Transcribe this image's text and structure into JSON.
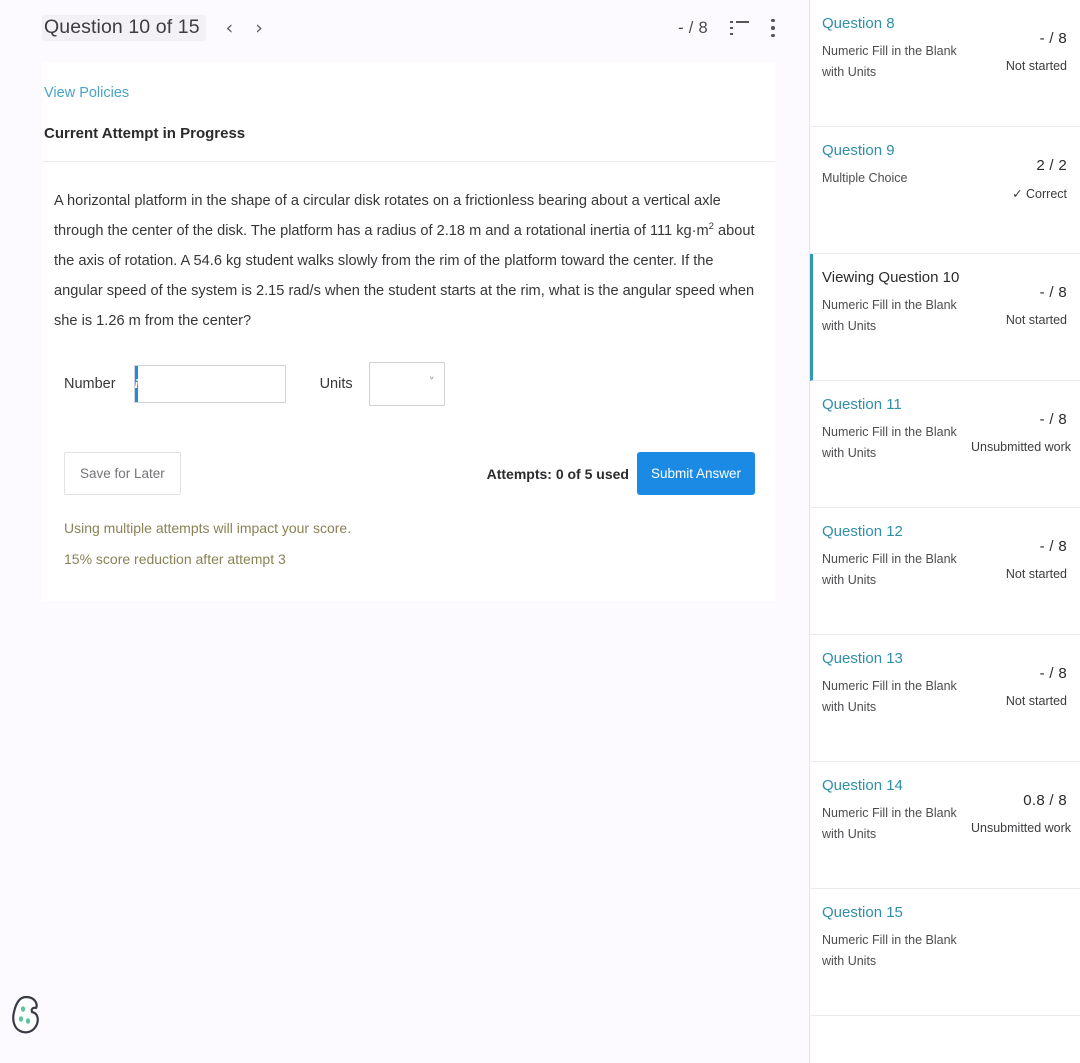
{
  "header": {
    "title": "Question 10 of 15",
    "prev_arrow": "‹",
    "next_arrow": "›",
    "score": "- / 8",
    "list_icon": "list-icon",
    "menu_icon": "kebab-menu-icon"
  },
  "card": {
    "policies_link": "View Policies",
    "attempt_heading": "Current Attempt in Progress",
    "question_text_part1": "A horizontal platform in the shape of a circular disk rotates on a frictionless bearing about a vertical axle through the center of the disk. The platform has a radius of 2.18 m and a rotational inertia of 111 kg·m",
    "question_exponent": "2",
    "question_text_part2": " about the axis of rotation. A 54.6 kg student walks slowly from the rim of the platform toward the center. If the angular speed of the system is 2.15 rad/s when the student starts at the rim, what is the angular speed when she is 1.26 m from the center?",
    "number_label": "Number",
    "number_value": "",
    "number_placeholder": "",
    "info_badge": "i",
    "units_label": "Units",
    "units_value": "",
    "units_chevron": "˅",
    "save_label": "Save for Later",
    "attempts_text": "Attempts: 0 of 5 used",
    "submit_label": "Submit Answer",
    "notice_1": "Using multiple attempts will impact your score.",
    "notice_2": "15% score reduction after attempt 3"
  },
  "sidebar": {
    "questions": [
      {
        "name": "Question 8",
        "type": "Numeric Fill in the Blank with Units",
        "score": "- / 8",
        "status": "Not started",
        "active": false
      },
      {
        "name": "Question 9",
        "type": "Multiple Choice",
        "score": "2 / 2",
        "status": "✓ Correct",
        "active": false
      },
      {
        "name": "Viewing Question 10",
        "type": "Numeric Fill in the Blank with Units",
        "score": "- / 8",
        "status": "Not started",
        "active": true
      },
      {
        "name": "Question 11",
        "type": "Numeric Fill in the Blank with Units",
        "score": "- / 8",
        "status": "Unsubmitted work",
        "active": false
      },
      {
        "name": "Question 12",
        "type": "Numeric Fill in the Blank with Units",
        "score": "- / 8",
        "status": "Not started",
        "active": false
      },
      {
        "name": "Question 13",
        "type": "Numeric Fill in the Blank with Units",
        "score": "- / 8",
        "status": "Not started",
        "active": false
      },
      {
        "name": "Question 14",
        "type": "Numeric Fill in the Blank with Units",
        "score": "0.8 / 8",
        "status": "Unsubmitted work",
        "active": false
      },
      {
        "name": "Question 15",
        "type": "Numeric Fill in the Blank with Units",
        "score": "",
        "status": "",
        "active": false
      }
    ]
  },
  "overlay": {
    "thumbnail": "browser-window-preview-thumbnail"
  },
  "cookie": {
    "icon": "cookie-consent-icon"
  },
  "colors": {
    "accent_blue": "#1b8ae4",
    "link_teal": "#2f8fa8",
    "active_border": "#2f9ab0",
    "notice_olive": "#8a8255",
    "page_bg": "#fdfaff"
  }
}
